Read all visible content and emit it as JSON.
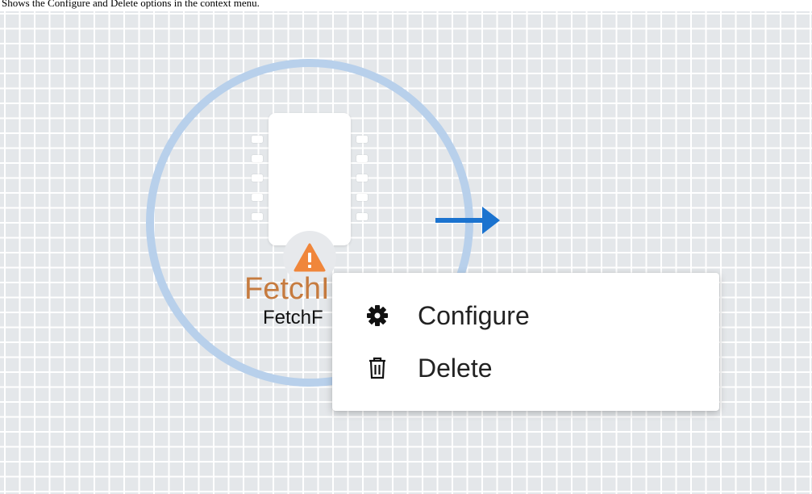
{
  "caption": "Shows the Configure and Delete options in the context menu.",
  "processor": {
    "name_truncated": "FetchI",
    "type_truncated": "FetchF",
    "status": "warning",
    "status_icon": "warning-triangle-icon"
  },
  "connection_arrow_icon": "arrow-right-icon",
  "context_menu": {
    "items": [
      {
        "label": "Configure",
        "icon": "gear-icon"
      },
      {
        "label": "Delete",
        "icon": "trash-icon"
      }
    ]
  },
  "colors": {
    "canvas_bg": "#e4e7ea",
    "grid_line": "#ffffff",
    "selection_ring": "#b8d0eb",
    "connection_arrow": "#1b73cf",
    "warning": "#f0863b",
    "processor_name": "#c67b3f"
  }
}
